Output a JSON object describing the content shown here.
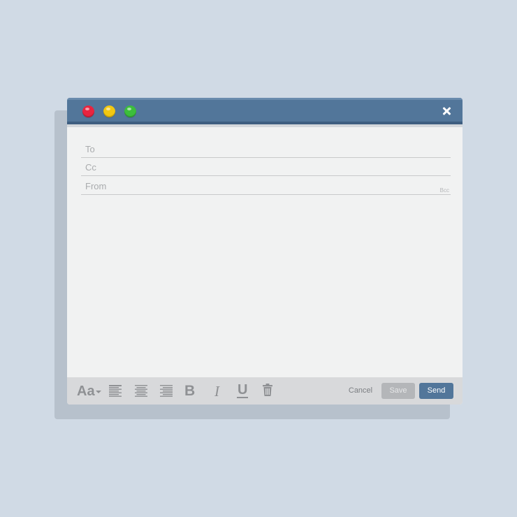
{
  "window": {
    "controls": {
      "close_icon": "close-icon",
      "traffic_lights": [
        {
          "name": "close-dot",
          "color": "#e8243f"
        },
        {
          "name": "minimize-dot",
          "color": "#f2c811"
        },
        {
          "name": "maximize-dot",
          "color": "#3cbe3c"
        }
      ]
    },
    "accent_color": "#52769a"
  },
  "fields": {
    "to": {
      "label": "To",
      "value": ""
    },
    "cc": {
      "label": "Cc",
      "value": ""
    },
    "from": {
      "label": "From",
      "value": ""
    },
    "bcc_link": "Bcc"
  },
  "body": {
    "value": ""
  },
  "toolbar": {
    "font_label": "Aa",
    "bold_label": "B",
    "italic_label": "I",
    "underline_label": "U",
    "icons": [
      "font-size-icon",
      "align-left-icon",
      "align-center-icon",
      "align-right-icon",
      "bold-icon",
      "italic-icon",
      "underline-icon",
      "trash-icon"
    ],
    "cancel_label": "Cancel",
    "save_label": "Save",
    "send_label": "Send"
  }
}
